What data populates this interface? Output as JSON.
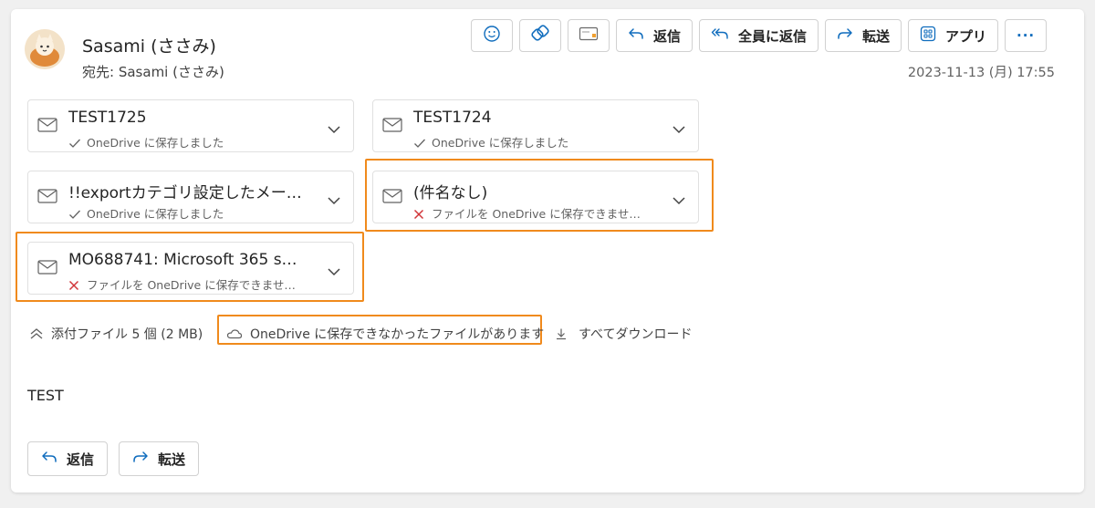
{
  "message": {
    "sender_name": "Sasami (ささみ)",
    "recipient_prefix": "宛先:",
    "recipient_name": "Sasami (ささみ)",
    "date": "2023-11-13 (月) 17:55",
    "body": "TEST"
  },
  "toolbar": {
    "emoji_icon": "smiley-icon",
    "loop_icon": "loop-icon",
    "immersive_reader_icon": "reader-icon",
    "reply_label": "返信",
    "reply_all_label": "全員に返信",
    "forward_label": "転送",
    "apps_label": "アプリ",
    "more_label": "···"
  },
  "attachments": [
    {
      "name": "TEST1725",
      "status": "OneDrive に保存しました",
      "status_type": "success"
    },
    {
      "name": "TEST1724",
      "status": "OneDrive に保存しました",
      "status_type": "success"
    },
    {
      "name": "!!exportカテゴリ設定したメール…",
      "status": "OneDrive に保存しました",
      "status_type": "success"
    },
    {
      "name": "(件名なし)",
      "status": "ファイルを OneDrive に保存できませ…",
      "status_type": "error"
    },
    {
      "name": "MO688741: Microsoft 365 s…",
      "status": "ファイルを OneDrive に保存できませ…",
      "status_type": "error"
    }
  ],
  "attachment_summary": {
    "count_label": "添付ファイル 5 個 (2 MB)",
    "onedrive_warning": "OneDrive に保存できなかったファイルがあります",
    "download_all": "すべてダウンロード"
  },
  "bottom_actions": {
    "reply_label": "返信",
    "forward_label": "転送"
  },
  "colors": {
    "highlight": "#f08a1c",
    "error": "#d13438",
    "accent": "#0f6cbd"
  }
}
